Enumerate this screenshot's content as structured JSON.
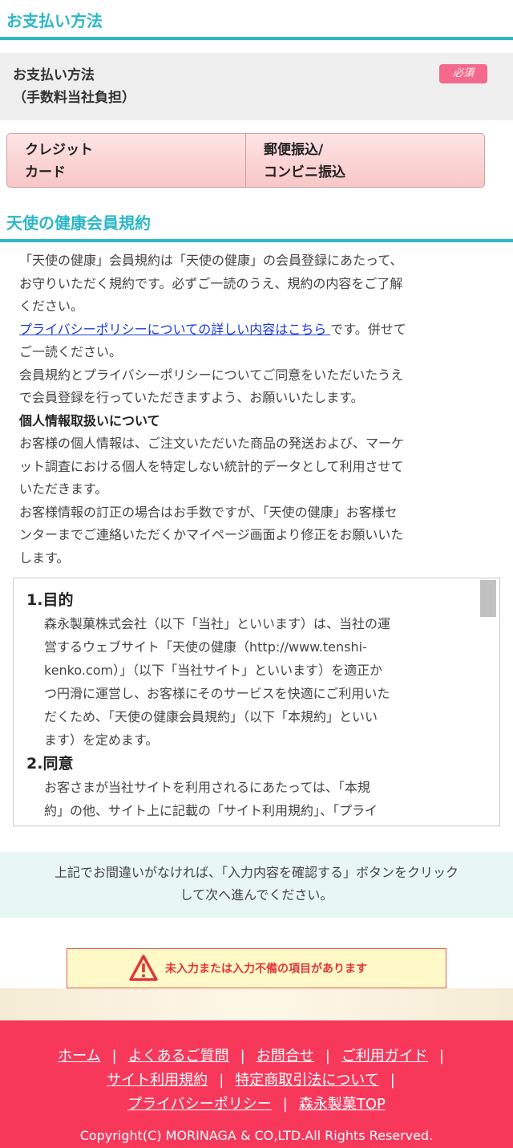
{
  "payment": {
    "title": "お支払い方法",
    "label_line1": "お支払い方法",
    "label_line2": "（手数料当社負担）",
    "required": "必須",
    "options": [
      {
        "line1": "クレジット",
        "line2": "カード"
      },
      {
        "line1": "郵便振込/",
        "line2": "コンビニ振込"
      }
    ]
  },
  "terms": {
    "title": "天使の健康会員規約",
    "intro_lines": [
      "「天使の健康」会員規約は「天使の健康」の会員登録にあたって、",
      "お守りいただく規約です。必ずご一読のうえ、規約の内容をご了解",
      "ください。"
    ],
    "privacy_link": "プライバシーポリシーについての詳しい内容はこちら ",
    "privacy_after": "です。併せて",
    "lines_after_link": [
      "ご一読ください。",
      "会員規約とプライバシーポリシーについてご同意をいただいたうえ",
      "で会員登録を行っていただきますよう、お願いいたします。"
    ],
    "personal_heading": "個人情報取扱いについて",
    "personal_lines": [
      "お客様の個人情報は、ご注文いただいた商品の発送および、マーケ",
      "ット調査における個人を特定しない統計的データとして利用させて",
      "いただきます。",
      "お客様情報の訂正の場合はお手数ですが、「天使の健康」お客様セ",
      "ンターまでご連絡いただくかマイページ画面より修正をお願いいた",
      "します。"
    ],
    "box": {
      "h1": "1.目的",
      "p1": [
        "森永製菓株式会社（以下「当社」といいます）は、当社の運",
        "営するウェブサイト「天使の健康（http://www.tenshi-",
        "kenko.com）」（以下「当社サイト」といいます）を適正か",
        "つ円滑に運営し、お客様にそのサービスを快適にご利用いた",
        "だくため、「天使の健康会員規約」（以下「本規約」といい",
        "ます）を定めます。"
      ],
      "h2": "2.同意",
      "p2": [
        "お客さまが当社サイトを利用されるにあたっては、「本規",
        "約」の他、サイト上に記載の「サイト利用規約」、「プライ"
      ]
    }
  },
  "notice": {
    "line1": "上記でお間違いがなければ、「入力内容を確認する」ボタンをクリック",
    "line2": "して次へ進んでください。"
  },
  "error": {
    "text": "未入力または入力不備の項目があります"
  },
  "footer": {
    "links": {
      "home": "ホーム",
      "faq": "よくあるご質問",
      "contact": "お問合せ",
      "guide": "ご利用ガイド",
      "site_terms": "サイト利用規約",
      "commerce_law": "特定商取引法について",
      "privacy": "プライバシーポリシー",
      "morinaga_top": "森永製菓TOP"
    },
    "separator": "|",
    "copyright": "Copyright(C) MORINAGA & CO,LTD.All Rights Reserved."
  },
  "colors": {
    "accent": "#2cb7c8",
    "required_badge": "#f4698c",
    "footer_bg": "#f7385b",
    "error_red": "#e0363c",
    "link": "#1a3bd9"
  },
  "icons": {
    "warning": "warning-triangle-icon"
  }
}
